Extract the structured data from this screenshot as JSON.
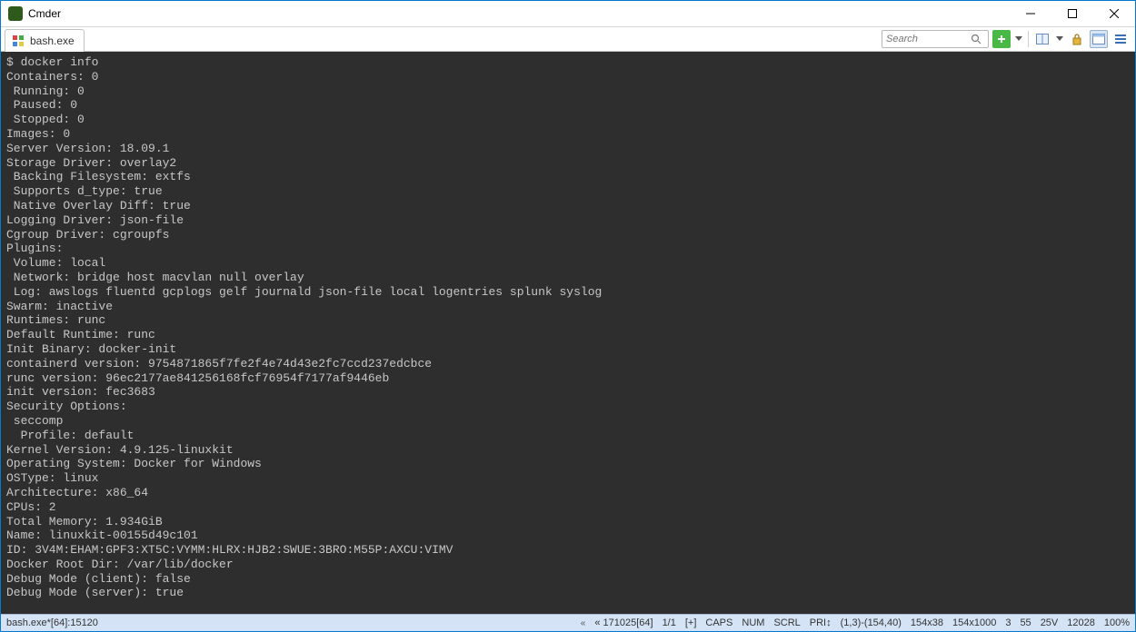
{
  "window": {
    "title": "Cmder"
  },
  "tab": {
    "label": "bash.exe"
  },
  "search": {
    "placeholder": "Search"
  },
  "terminal": {
    "prompt_line": "$ docker info",
    "lines": [
      "Containers: 0",
      " Running: 0",
      " Paused: 0",
      " Stopped: 0",
      "Images: 0",
      "Server Version: 18.09.1",
      "Storage Driver: overlay2",
      " Backing Filesystem: extfs",
      " Supports d_type: true",
      " Native Overlay Diff: true",
      "Logging Driver: json-file",
      "Cgroup Driver: cgroupfs",
      "Plugins:",
      " Volume: local",
      " Network: bridge host macvlan null overlay",
      " Log: awslogs fluentd gcplogs gelf journald json-file local logentries splunk syslog",
      "Swarm: inactive",
      "Runtimes: runc",
      "Default Runtime: runc",
      "Init Binary: docker-init",
      "containerd version: 9754871865f7fe2f4e74d43e2fc7ccd237edcbce",
      "runc version: 96ec2177ae841256168fcf76954f7177af9446eb",
      "init version: fec3683",
      "Security Options:",
      " seccomp",
      "  Profile: default",
      "Kernel Version: 4.9.125-linuxkit",
      "Operating System: Docker for Windows",
      "OSType: linux",
      "Architecture: x86_64",
      "CPUs: 2",
      "Total Memory: 1.934GiB",
      "Name: linuxkit-00155d49c101",
      "ID: 3V4M:EHAM:GPF3:XT5C:VYMM:HLRX:HJB2:SWUE:3BRO:M55P:AXCU:VIMV",
      "Docker Root Dir: /var/lib/docker",
      "Debug Mode (client): false",
      "Debug Mode (server): true"
    ]
  },
  "status": {
    "proc": "bash.exe*[64]:15120",
    "buf": "« 171025[64]",
    "pages": "1/1",
    "plus": "[+]",
    "caps": "CAPS",
    "num": "NUM",
    "scrl": "SCRL",
    "pri": "PRI↕",
    "cursor": "(1,3)-(154,40)",
    "size": "154x38",
    "buffer": "154x1000",
    "c1": "3",
    "c2": "55",
    "c3": "25V",
    "pid": "12028",
    "zoom": "100%"
  }
}
